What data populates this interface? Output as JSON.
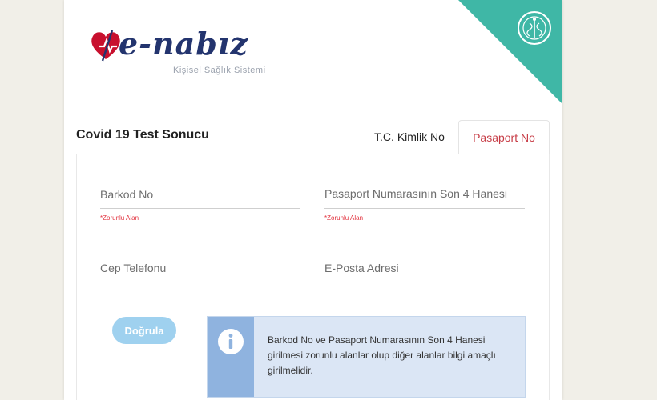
{
  "logo": {
    "brand": "e-nabız",
    "subtitle": "Kişisel Sağlık Sistemi"
  },
  "colors": {
    "accent_teal": "#3fb7a6",
    "brand_navy": "#23346e",
    "brand_red": "#c8102e",
    "active_tab": "#c73c46",
    "required_red": "#e2333f",
    "button_blue": "#9fd1ef",
    "info_bg": "#dbe6f5",
    "info_side": "#8fb3df"
  },
  "page": {
    "title": "Covid 19 Test Sonucu"
  },
  "tabs": [
    {
      "label": "T.C. Kimlik No",
      "active": false
    },
    {
      "label": "Pasaport No",
      "active": true
    }
  ],
  "form": {
    "barcode": {
      "label": "Barkod No",
      "value": "",
      "required_note": "*Zorunlu Alan"
    },
    "passport_last4": {
      "label": "Pasaport Numarasının Son 4 Hanesi",
      "value": "",
      "required_note": "*Zorunlu Alan"
    },
    "phone": {
      "label": "Cep Telefonu",
      "value": ""
    },
    "email": {
      "label": "E-Posta Adresi",
      "value": ""
    },
    "verify_label": "Doğrula"
  },
  "info": {
    "icon": "info-icon",
    "message": "Barkod No ve Pasaport Numarasının Son 4 Hanesi girilmesi zorunlu alanlar olup diğer alanlar bilgi amaçlı girilmelidir."
  }
}
